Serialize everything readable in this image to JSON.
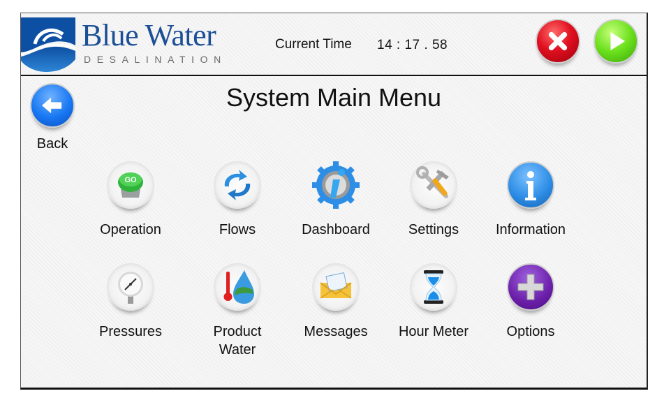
{
  "header": {
    "brand_title": "Blue Water",
    "brand_subtitle": "DESALINATION",
    "time_label": "Current Time",
    "time_value": "14 : 17 . 58",
    "stop_button": {
      "icon": "close-icon",
      "color": "#e01020"
    },
    "go_button": {
      "icon": "play-icon",
      "color": "#6be01c"
    }
  },
  "page": {
    "title": "System Main Menu",
    "back_label": "Back"
  },
  "menu": {
    "row1": [
      {
        "label": "Operation",
        "icon": "go-button-icon"
      },
      {
        "label": "Flows",
        "icon": "refresh-arrows-icon"
      },
      {
        "label": "Dashboard",
        "icon": "gear-info-icon"
      },
      {
        "label": "Settings",
        "icon": "tools-icon"
      },
      {
        "label": "Information",
        "icon": "info-icon"
      }
    ],
    "row2": [
      {
        "label": "Pressures",
        "icon": "pressure-gauge-icon"
      },
      {
        "label": "Product Water",
        "icon": "thermometer-water-drop-icon"
      },
      {
        "label": "Messages",
        "icon": "envelope-icon"
      },
      {
        "label": "Hour Meter",
        "icon": "hourglass-icon"
      },
      {
        "label": "Options",
        "icon": "plus-icon"
      }
    ]
  },
  "colors": {
    "brand_blue": "#1c4f96",
    "info_blue": "#1877f2",
    "options_purple": "#6a1fa8"
  }
}
